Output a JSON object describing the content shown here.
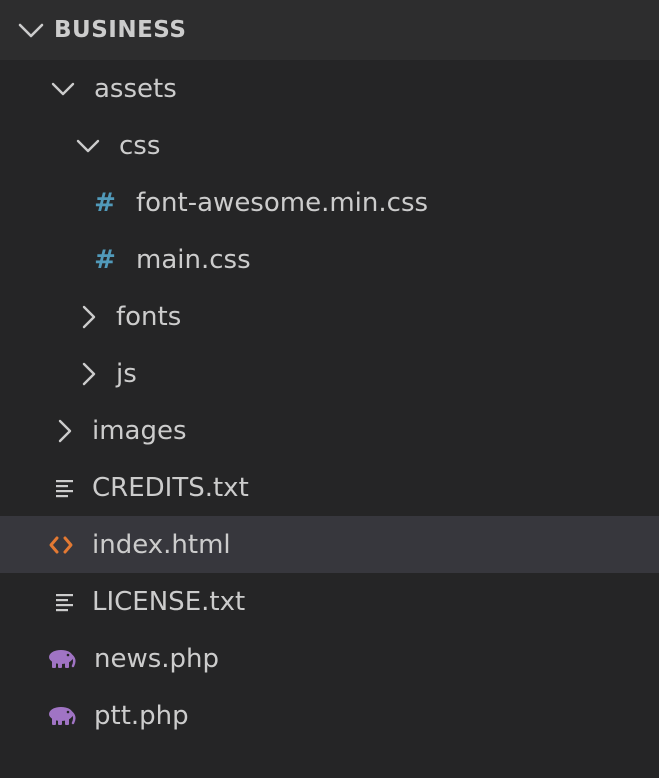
{
  "explorer": {
    "section_title": "BUSINESS",
    "items": [
      {
        "label": "assets",
        "type": "folder",
        "expanded": true,
        "depth": 1
      },
      {
        "label": "css",
        "type": "folder",
        "expanded": true,
        "depth": 2
      },
      {
        "label": "font-awesome.min.css",
        "type": "css-file",
        "depth": 3
      },
      {
        "label": "main.css",
        "type": "css-file",
        "depth": 3
      },
      {
        "label": "fonts",
        "type": "folder",
        "expanded": false,
        "depth": 2
      },
      {
        "label": "js",
        "type": "folder",
        "expanded": false,
        "depth": 2
      },
      {
        "label": "images",
        "type": "folder",
        "expanded": false,
        "depth": 1
      },
      {
        "label": "CREDITS.txt",
        "type": "text-file",
        "depth": 1
      },
      {
        "label": "index.html",
        "type": "html-file",
        "depth": 1,
        "selected": true
      },
      {
        "label": "LICENSE.txt",
        "type": "text-file",
        "depth": 1
      },
      {
        "label": "news.php",
        "type": "php-file",
        "depth": 1
      },
      {
        "label": "ptt.php",
        "type": "php-file",
        "depth": 1
      }
    ],
    "icon_glyphs": {
      "css_file": "#"
    }
  },
  "colors": {
    "background": "#252526",
    "header_background": "#2d2d2e",
    "selected_row": "#37373d",
    "text": "#cccccc",
    "css_icon": "#519aba",
    "html_icon": "#e37933",
    "php_icon": "#a074c4"
  }
}
